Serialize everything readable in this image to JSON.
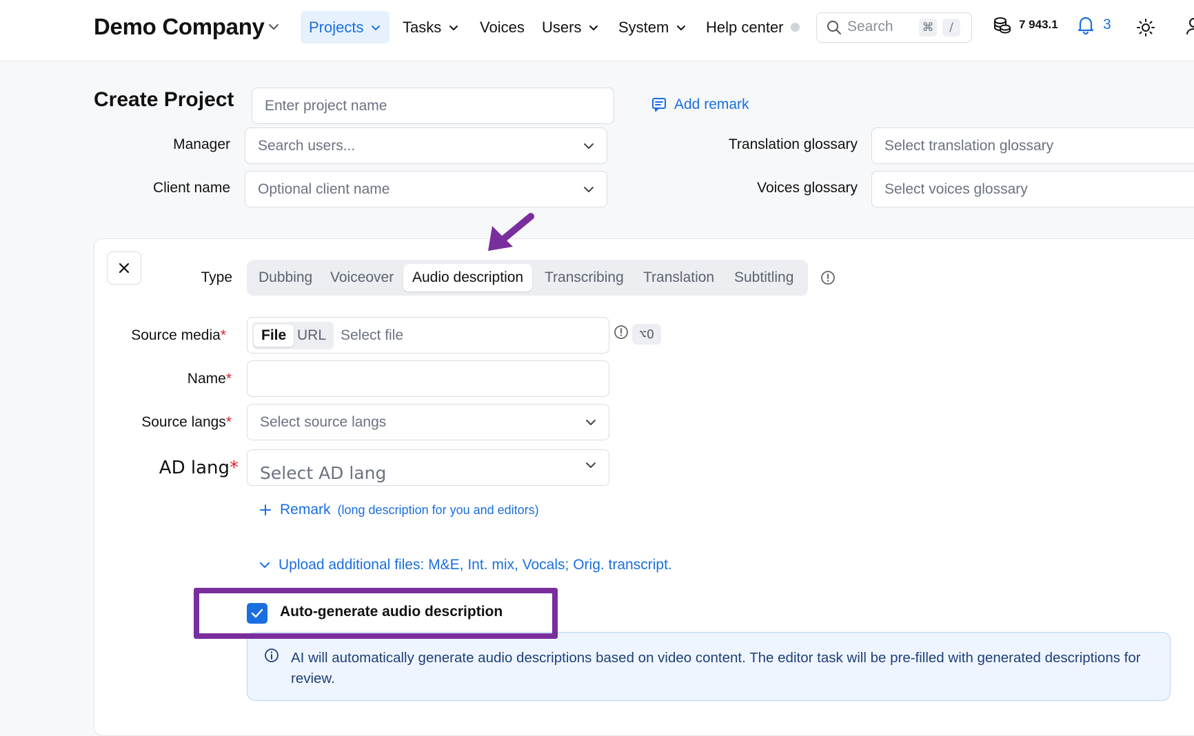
{
  "app": {
    "brand": "Demo Company"
  },
  "nav": {
    "items": [
      {
        "label": "Projects",
        "active": true,
        "has_menu": true
      },
      {
        "label": "Tasks",
        "has_menu": true
      },
      {
        "label": "Voices",
        "has_menu": false
      },
      {
        "label": "Users",
        "has_menu": true
      },
      {
        "label": "System",
        "has_menu": true
      },
      {
        "label": "Help center",
        "has_status_dot": true
      }
    ],
    "search_placeholder": "Search",
    "search_shortcut": [
      "⌘",
      "/"
    ],
    "credits": "7 943.1",
    "notifications_count": "3"
  },
  "form": {
    "title": "Create Project",
    "project_name_placeholder": "Enter project name",
    "add_remark_label": "Add remark",
    "manager_label": "Manager",
    "manager_placeholder": "Search users...",
    "client_label": "Client name",
    "client_placeholder": "Optional client name",
    "translation_glossary_label": "Translation glossary",
    "translation_glossary_placeholder": "Select translation glossary",
    "voices_glossary_label": "Voices glossary",
    "voices_glossary_placeholder": "Select voices glossary"
  },
  "task": {
    "type_label": "Type",
    "types": [
      "Dubbing",
      "Voiceover",
      "Audio description",
      "Transcribing",
      "Translation",
      "Subtitling"
    ],
    "selected_type": "Audio description",
    "source_media_label": "Source media",
    "source_media_modes": [
      "File",
      "URL"
    ],
    "selected_source_mode": "File",
    "source_media_placeholder": "Select file",
    "shortcut": "⌥O",
    "name_label": "Name",
    "source_langs_label": "Source langs",
    "source_langs_placeholder": "Select source langs",
    "ad_lang_label": "AD lang",
    "ad_lang_placeholder": "Select AD lang",
    "remark_label": "Remark",
    "remark_hint": "(long description for you and editors)",
    "upload_label": "Upload additional files: M&E, Int. mix, Vocals; Orig. transcript.",
    "auto_generate_label": "Auto-generate audio description",
    "auto_generate_checked": true,
    "info_text": "AI will automatically generate audio descriptions based on video content. The editor task will be pre-filled with generated descriptions for review.",
    "required_marker": "*"
  },
  "colors": {
    "accent": "#1a6fe0",
    "annotation": "#7a2e9e",
    "required": "#e11d2e",
    "info_bg": "#eef5fe"
  },
  "icons": [
    "chevron-down-icon",
    "search-icon",
    "coins-icon",
    "bell-icon",
    "sun-icon",
    "user-icon",
    "comment-icon",
    "close-icon",
    "info-icon",
    "plus-icon",
    "check-icon",
    "annotation-arrow-icon"
  ]
}
